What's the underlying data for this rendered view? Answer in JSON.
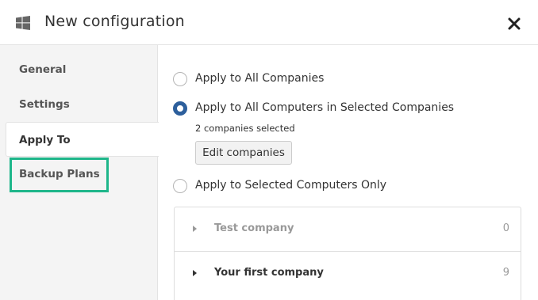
{
  "header": {
    "title": "New configuration",
    "os_icon": "windows-icon",
    "close_icon": "close-icon"
  },
  "sidebar": {
    "items": [
      {
        "label": "General",
        "active": false
      },
      {
        "label": "Settings",
        "active": false
      },
      {
        "label": "Apply To",
        "active": true
      },
      {
        "label": "Backup Plans",
        "active": false,
        "highlighted": true
      }
    ]
  },
  "apply_to": {
    "options": [
      {
        "label": "Apply to All Companies",
        "checked": false
      },
      {
        "label": "Apply to All Computers in Selected Companies",
        "checked": true
      },
      {
        "label": "Apply to Selected Computers Only",
        "checked": false
      }
    ],
    "selected_note": "2 companies selected",
    "edit_button_label": "Edit companies"
  },
  "companies": [
    {
      "name": "Test company",
      "count": "0",
      "muted": true
    },
    {
      "name": "Your first company",
      "count": "9",
      "muted": false
    }
  ],
  "colors": {
    "accent": "#2d5f9c",
    "highlight": "#1eb68a",
    "sidebar_bg": "#f4f4f4"
  }
}
